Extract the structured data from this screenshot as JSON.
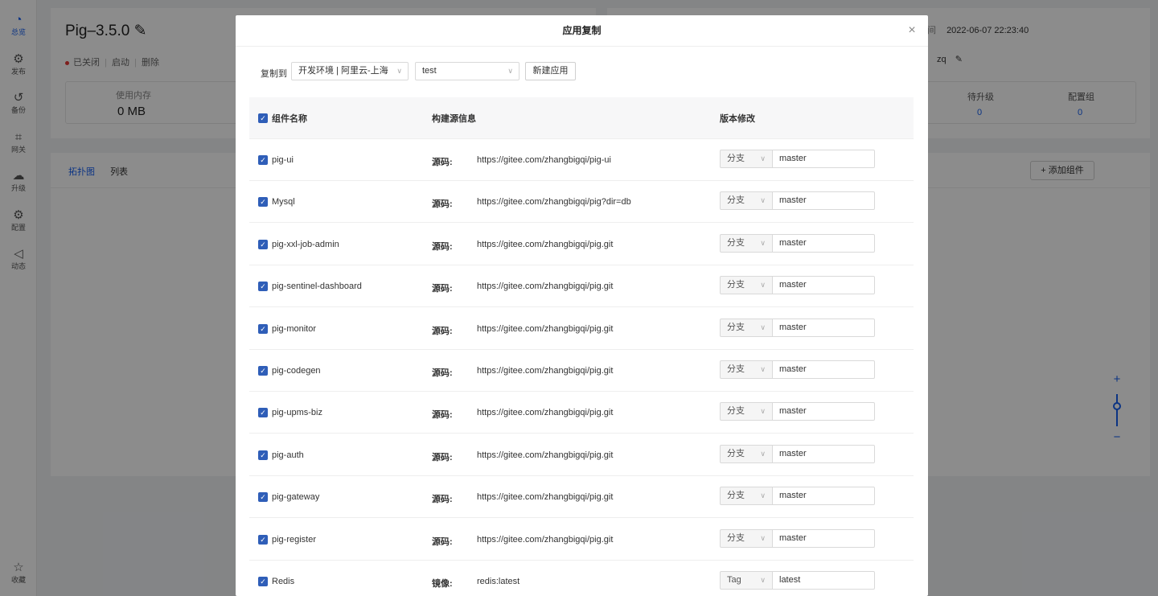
{
  "rail": {
    "items": [
      {
        "icon": "dashboard-icon",
        "glyph": "◔",
        "label": "总览"
      },
      {
        "icon": "publish-icon",
        "glyph": "⚙",
        "label": "发布"
      },
      {
        "icon": "backup-icon",
        "glyph": "↺",
        "label": "备份"
      },
      {
        "icon": "gateway-icon",
        "glyph": "⌗",
        "label": "网关"
      },
      {
        "icon": "upgrade-icon",
        "glyph": "☁",
        "label": "升级"
      },
      {
        "icon": "config-icon",
        "glyph": "⚙",
        "label": "配置"
      },
      {
        "icon": "activity-icon",
        "glyph": "◁",
        "label": "动态"
      }
    ],
    "favorite": {
      "icon": "star-icon",
      "glyph": "☆",
      "label": "收藏"
    }
  },
  "app": {
    "title": "Pig–3.5.0",
    "edit_glyph": "✎",
    "status": "已关闭",
    "start": "启动",
    "delete": "删除",
    "memory_label": "使用内存",
    "memory_value": "0 MB",
    "time_label": "间",
    "time_value": "2022-06-07 22:23:40",
    "owner": "zq",
    "pending_label": "待升级",
    "pending_value": "0",
    "config_group_label": "配置组",
    "config_group_value": "0",
    "tab_topology": "拓扑图",
    "tab_list": "列表",
    "add_component": "+ 添加组件",
    "zoom_in": "+",
    "zoom_out": "−"
  },
  "modal": {
    "title": "应用复制",
    "close": "×",
    "copy_to_label": "复制到",
    "env_select": "开发环境 | 阿里云-上海",
    "app_select": "test",
    "new_app_button": "新建应用",
    "col_name": "组件名称",
    "col_source": "构建源信息",
    "col_version": "版本修改",
    "rows": [
      {
        "name": "pig-ui",
        "src_label": "源码:",
        "src": "https://gitee.com/zhangbigqi/pig-ui",
        "vtype": "分支",
        "version": "master"
      },
      {
        "name": "Mysql",
        "src_label": "源码:",
        "src": "https://gitee.com/zhangbigqi/pig?dir=db",
        "vtype": "分支",
        "version": "master"
      },
      {
        "name": "pig-xxl-job-admin",
        "src_label": "源码:",
        "src": "https://gitee.com/zhangbigqi/pig.git",
        "vtype": "分支",
        "version": "master"
      },
      {
        "name": "pig-sentinel-dashboard",
        "src_label": "源码:",
        "src": "https://gitee.com/zhangbigqi/pig.git",
        "vtype": "分支",
        "version": "master"
      },
      {
        "name": "pig-monitor",
        "src_label": "源码:",
        "src": "https://gitee.com/zhangbigqi/pig.git",
        "vtype": "分支",
        "version": "master"
      },
      {
        "name": "pig-codegen",
        "src_label": "源码:",
        "src": "https://gitee.com/zhangbigqi/pig.git",
        "vtype": "分支",
        "version": "master"
      },
      {
        "name": "pig-upms-biz",
        "src_label": "源码:",
        "src": "https://gitee.com/zhangbigqi/pig.git",
        "vtype": "分支",
        "version": "master"
      },
      {
        "name": "pig-auth",
        "src_label": "源码:",
        "src": "https://gitee.com/zhangbigqi/pig.git",
        "vtype": "分支",
        "version": "master"
      },
      {
        "name": "pig-gateway",
        "src_label": "源码:",
        "src": "https://gitee.com/zhangbigqi/pig.git",
        "vtype": "分支",
        "version": "master"
      },
      {
        "name": "pig-register",
        "src_label": "源码:",
        "src": "https://gitee.com/zhangbigqi/pig.git",
        "vtype": "分支",
        "version": "master"
      },
      {
        "name": "Redis",
        "src_label": "镜像:",
        "src": "redis:latest",
        "vtype": "Tag",
        "version": "latest"
      }
    ]
  }
}
